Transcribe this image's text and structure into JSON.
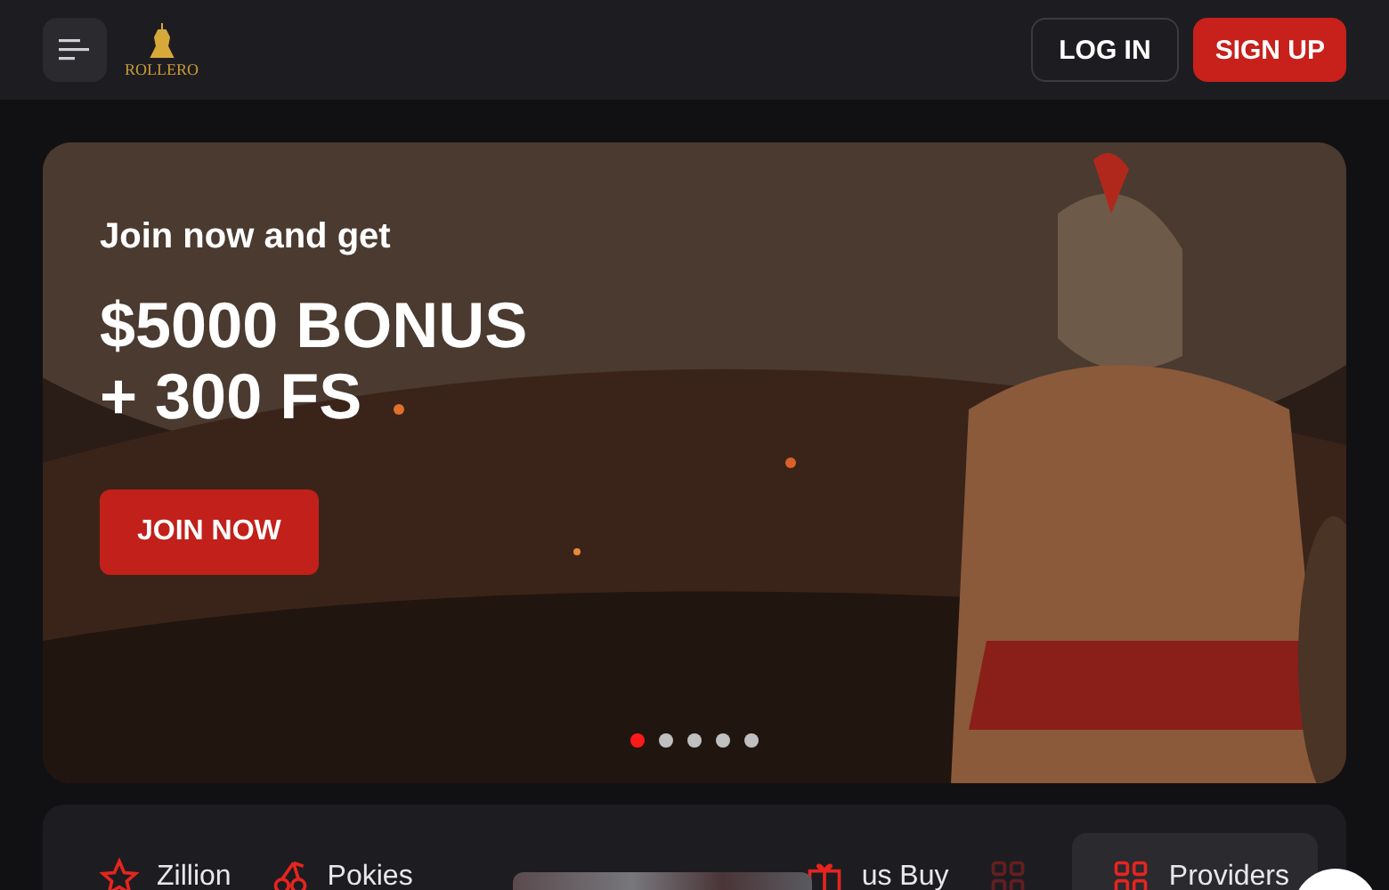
{
  "header": {
    "logo_text": "ROLLERO",
    "login": "LOG IN",
    "signup": "SIGN UP"
  },
  "banner": {
    "kind": "picture",
    "intro": "Join now and get",
    "headline": [
      "$5000 BONUS",
      "+ 300 FS"
    ],
    "cta": "JOIN NOW",
    "dots": [
      {
        "selected": true
      },
      {
        "selected": false
      },
      {
        "selected": false
      },
      {
        "selected": false
      },
      {
        "selected": false
      }
    ]
  },
  "categories": [
    {
      "kind": "star",
      "label": "Zillion",
      "selected": false
    },
    {
      "kind": "cherry",
      "label": "Pokies",
      "selected": false
    },
    {
      "kind": "gift",
      "label": "us Buy",
      "selected": false
    },
    {
      "kind": "grid",
      "faded": true,
      "selected": false
    },
    {
      "kind": "grid",
      "label": "Providers",
      "selected": true
    }
  ]
}
